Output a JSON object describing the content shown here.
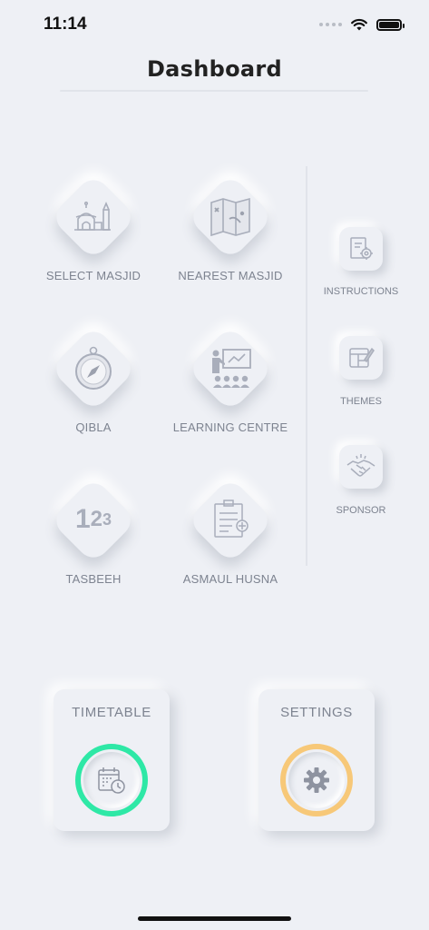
{
  "status": {
    "time": "11:14"
  },
  "header": {
    "title": "Dashboard"
  },
  "tiles": [
    {
      "label": "SELECT MASJID",
      "icon": "mosque-icon"
    },
    {
      "label": "NEAREST MASJID",
      "icon": "map-icon"
    },
    {
      "label": "QIBLA",
      "icon": "compass-icon"
    },
    {
      "label": "LEARNING CENTRE",
      "icon": "classroom-icon"
    },
    {
      "label": "TASBEEH",
      "icon": "counter-icon",
      "glyph": "123"
    },
    {
      "label": "ASMAUL HUSNA",
      "icon": "document-add-icon"
    }
  ],
  "side": [
    {
      "label": "INSTRUCTIONS",
      "icon": "instructions-gear-icon"
    },
    {
      "label": "THEMES",
      "icon": "theme-edit-icon"
    },
    {
      "label": "SPONSOR",
      "icon": "handshake-icon"
    }
  ],
  "bottom": {
    "timetable": {
      "label": "TIMETABLE",
      "icon": "calendar-clock-icon",
      "ring_color": "#2ee8a6"
    },
    "settings": {
      "label": "SETTINGS",
      "icon": "gear-icon",
      "ring_color": "#f7c878"
    }
  }
}
